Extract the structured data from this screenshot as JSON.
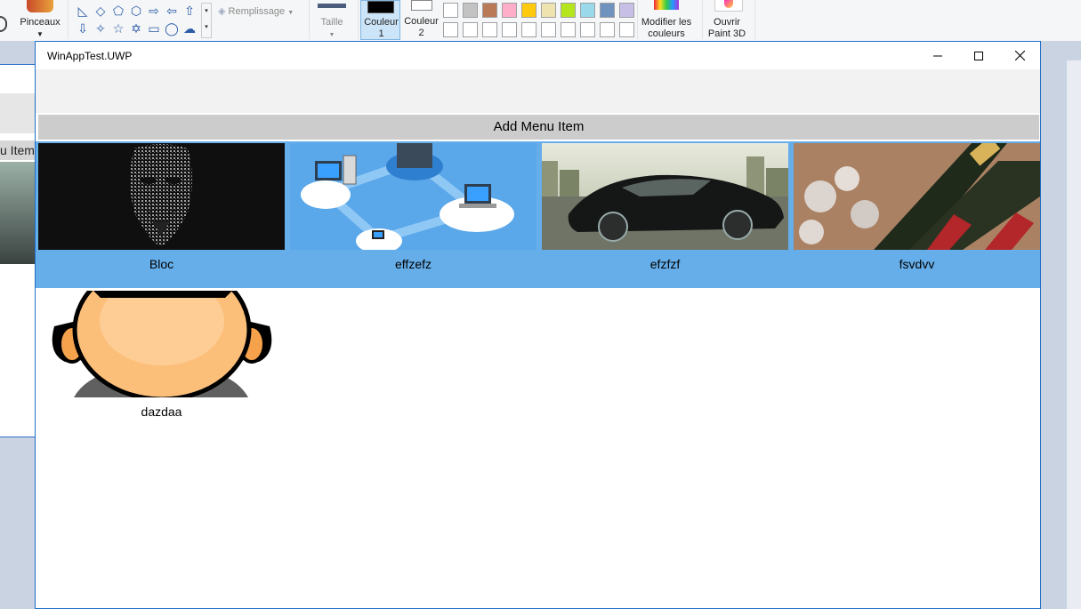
{
  "paint": {
    "pinceaux": "Pinceaux",
    "remplissage": "Remplissage",
    "taille": "Taille",
    "couleur1": [
      "Couleur",
      "1"
    ],
    "couleur2": [
      "Couleur",
      "2"
    ],
    "modifier": [
      "Modifier les",
      "couleurs"
    ],
    "ouvrir": [
      "Ouvrir",
      "Paint 3D"
    ],
    "behind_text": "u Item",
    "swatches_row1": [
      "#ffffff",
      "#c3c3c3",
      "#b97a57",
      "#ffaec9",
      "#ffc90e",
      "#efe4b0",
      "#b5e61d",
      "#99d9ea",
      "#7092be",
      "#c8bfe7"
    ],
    "swatches_row2": [
      "#ffffff",
      "#ffffff",
      "#ffffff",
      "#ffffff",
      "#ffffff",
      "#ffffff",
      "#ffffff",
      "#ffffff",
      "#ffffff",
      "#ffffff"
    ]
  },
  "window": {
    "title": "WinAppTest.UWP",
    "add_button": "Add Menu Item",
    "selection_color": "#66aee9",
    "items": [
      {
        "label": "Bloc",
        "image": "anonymous-mask-image"
      },
      {
        "label": "effzefz",
        "image": "network-diagram-image"
      },
      {
        "label": "efzfzf",
        "image": "black-car-image"
      },
      {
        "label": "fsvdvv",
        "image": "champagne-bottles-image"
      },
      {
        "label": "dazdaa",
        "image": "avatar-face-image"
      }
    ]
  }
}
